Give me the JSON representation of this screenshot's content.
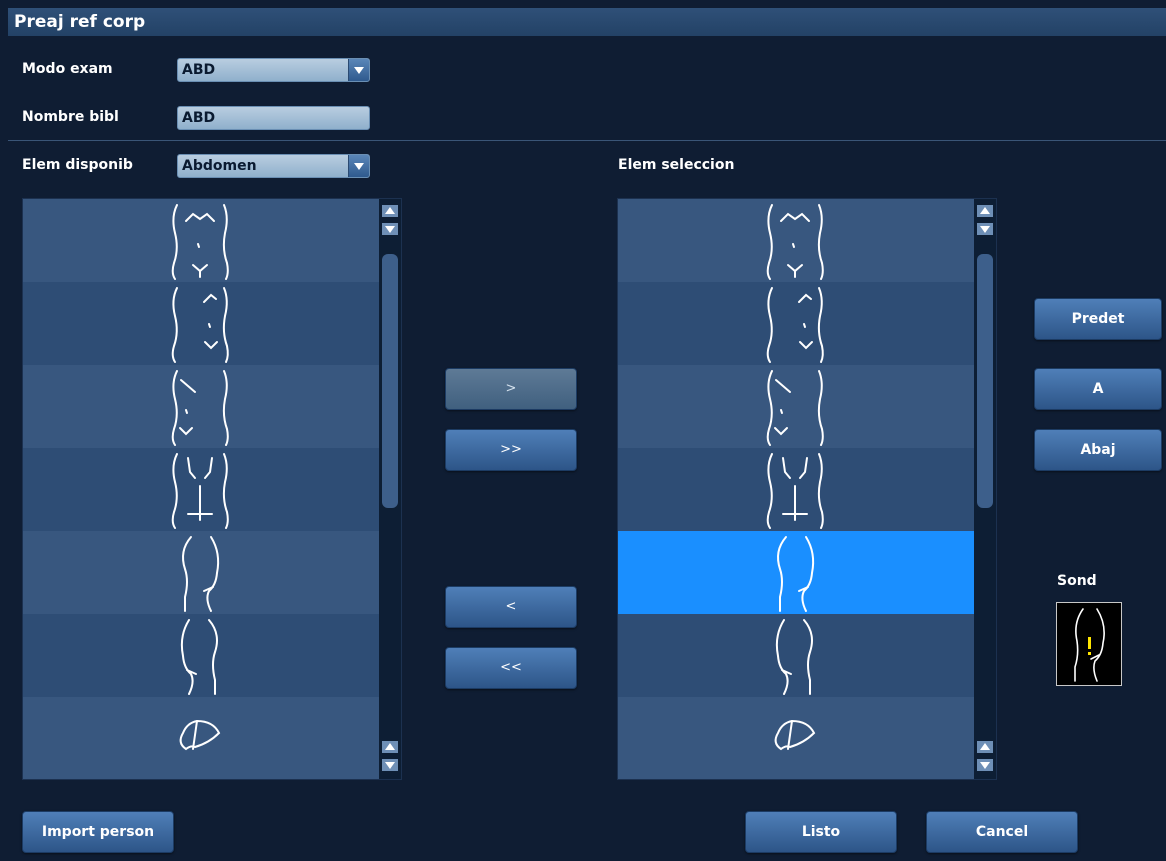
{
  "window": {
    "title": "Preaj ref corp"
  },
  "exam_mode": {
    "label": "Modo exam",
    "value": "ABD"
  },
  "library_name": {
    "label": "Nombre bibl",
    "value": "ABD"
  },
  "available": {
    "label": "Elem disponib",
    "category": "Abdomen",
    "items": [
      {
        "icon": "body-front-icon"
      },
      {
        "icon": "body-front-right-upper-icon"
      },
      {
        "icon": "body-front-left-upper-icon"
      },
      {
        "icon": "body-front-lower-icon"
      },
      {
        "icon": "body-side-right-icon"
      },
      {
        "icon": "body-side-left-icon"
      },
      {
        "icon": "liver-icon"
      }
    ]
  },
  "selected": {
    "label": "Elem seleccion",
    "selected_index": 4,
    "items": [
      {
        "icon": "body-front-icon"
      },
      {
        "icon": "body-front-right-upper-icon"
      },
      {
        "icon": "body-front-left-upper-icon"
      },
      {
        "icon": "body-front-lower-icon"
      },
      {
        "icon": "body-side-right-icon"
      },
      {
        "icon": "body-side-left-icon"
      },
      {
        "icon": "liver-icon"
      }
    ]
  },
  "transfer": {
    "add": ">",
    "add_all": ">>",
    "remove": "<",
    "remove_all": "<<"
  },
  "order": {
    "default": "Predet",
    "up": "A",
    "down": "Abaj"
  },
  "probe": {
    "label": "Sond",
    "marker_color": "#ffe600"
  },
  "footer": {
    "import": "Import person",
    "done": "Listo",
    "cancel": "Cancel"
  },
  "colors": {
    "selection": "#1a8fff",
    "background": "#0f1d33"
  }
}
